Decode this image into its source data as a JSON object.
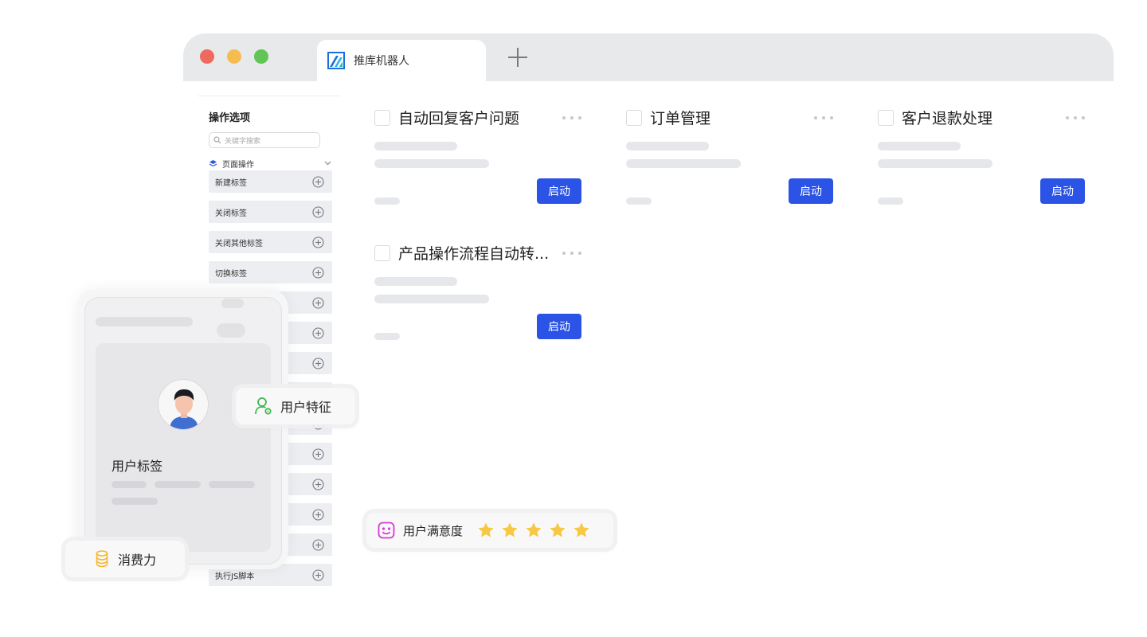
{
  "window": {
    "tab_title": "推库机器人",
    "traffic_lights": [
      "#ee6a5f",
      "#f5bd4f",
      "#61c454"
    ]
  },
  "sidebar": {
    "title": "操作选项",
    "search_placeholder": "关键字搜索",
    "group_label": "页面操作",
    "items": [
      {
        "label": "新建标签"
      },
      {
        "label": "关闭标签"
      },
      {
        "label": "关闭其他标签"
      },
      {
        "label": "切换标签"
      },
      {
        "label": ""
      },
      {
        "label": ""
      },
      {
        "label": ""
      },
      {
        "label": ""
      },
      {
        "label": ""
      },
      {
        "label": ""
      },
      {
        "label": ""
      },
      {
        "label": ""
      },
      {
        "label": ""
      },
      {
        "label": "执行JS脚本"
      }
    ]
  },
  "tasks": [
    {
      "title": "自动回复客户问题",
      "button": "启动"
    },
    {
      "title": "订单管理",
      "button": "启动"
    },
    {
      "title": "客户退款处理",
      "button": "启动"
    },
    {
      "title": "产品操作流程自动转...",
      "button": "启动"
    }
  ],
  "overlay": {
    "user_tags_label": "用户标签",
    "user_feature_label": "用户特征",
    "spending_label": "消费力",
    "satisfaction_label": "用户满意度",
    "satisfaction_rating": 5,
    "satisfaction_max": 5
  },
  "colors": {
    "accent": "#2b53e5",
    "star": "#f7c843",
    "feature_icon": "#3fb950",
    "spend_icon": "#f5b82e",
    "satisfaction_icon": "#d63bd6"
  }
}
